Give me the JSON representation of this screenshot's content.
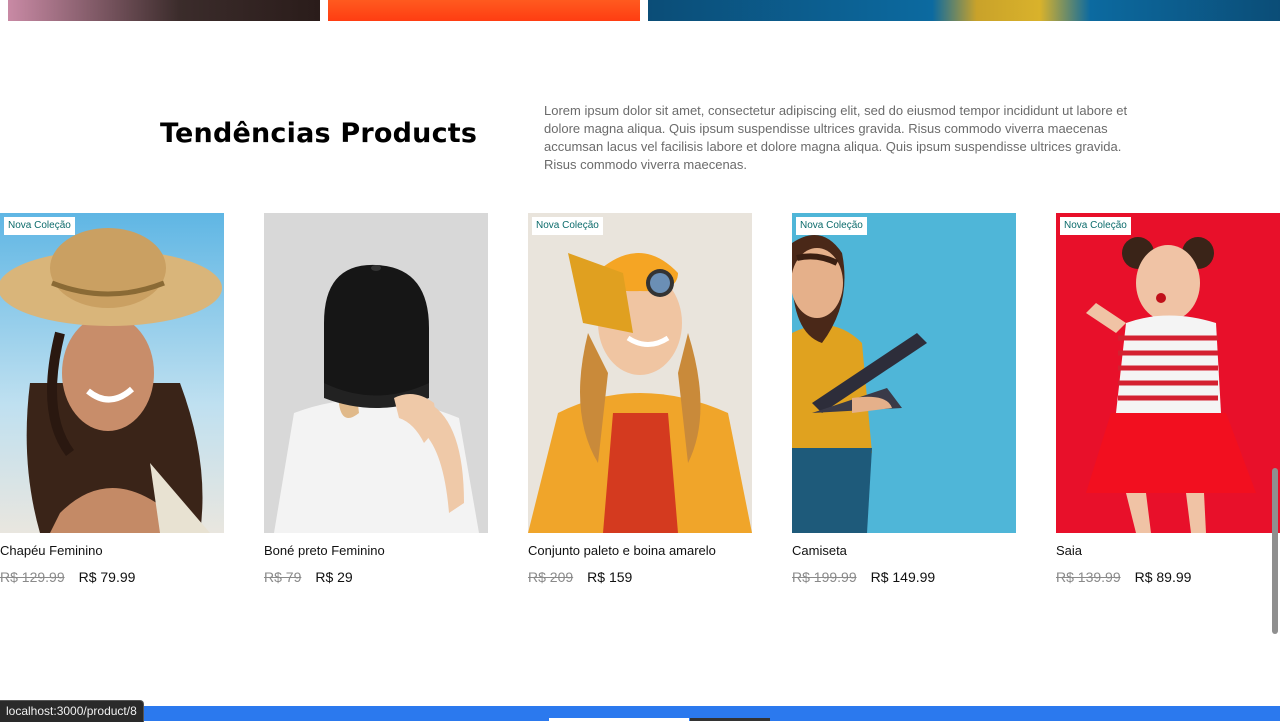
{
  "section": {
    "title": "Tendências Products",
    "description": "Lorem ipsum dolor sit amet, consectetur adipiscing elit, sed do eiusmod tempor incididunt ut labore et dolore magna aliqua. Quis ipsum suspendisse ultrices gravida. Risus commodo viverra maecenas accumsan lacus vel facilisis labore et dolore magna aliqua. Quis ipsum suspendisse ultrices gravida. Risus commodo viverra maecenas."
  },
  "products": [
    {
      "name": "Chapéu Feminino",
      "badge": "Nova Coleção",
      "old_price": "R$ 129.99",
      "price": "R$ 79.99"
    },
    {
      "name": "Boné preto Feminino",
      "badge": "",
      "old_price": "R$ 79",
      "price": "R$ 29"
    },
    {
      "name": "Conjunto paleto e boina amarelo",
      "badge": "Nova Coleção",
      "old_price": "R$ 209",
      "price": "R$ 159"
    },
    {
      "name": "Camiseta",
      "badge": "Nova Coleção",
      "old_price": "R$ 199.99",
      "price": "R$ 149.99"
    },
    {
      "name": "Saia",
      "badge": "Nova Coleção",
      "old_price": "R$ 139.99",
      "price": "R$ 89.99"
    }
  ],
  "status_bar": {
    "url": "localhost:3000/product/8"
  },
  "colors": {
    "badge_text": "#0b6b6b",
    "old_price": "#8a8a8a",
    "footer_blue": "#2b79ee"
  }
}
